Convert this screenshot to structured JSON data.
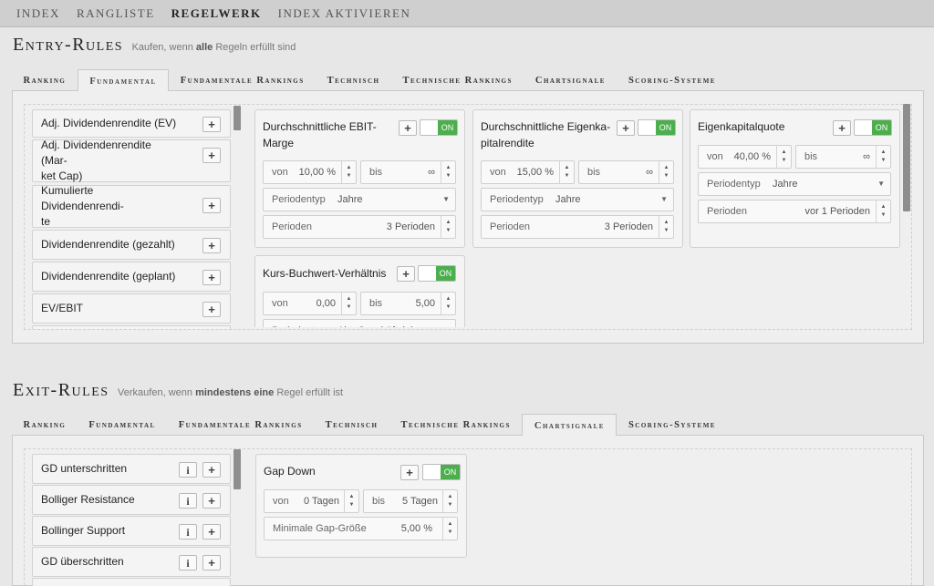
{
  "topnav": [
    {
      "label": "INDEX",
      "active": false
    },
    {
      "label": "RANGLISTE",
      "active": false
    },
    {
      "label": "REGELWERK",
      "active": true
    },
    {
      "label": "INDEX AKTIVIEREN",
      "active": false
    }
  ],
  "entry": {
    "title": "Entry-Rules",
    "sub_pre": "Kaufen, wenn ",
    "sub_bold": "alle",
    "sub_post": " Regeln erfüllt sind",
    "tabs": [
      "Ranking",
      "Fundamental",
      "Fundamentale Rankings",
      "Technisch",
      "Technische Rankings",
      "Chartsignale",
      "Scoring-Systeme"
    ],
    "active_tab": "Fundamental",
    "list": [
      "Adj. Dividendenrendite (EV)",
      "Adj. Dividendenrendite (Mar-\nket Cap)",
      "Kumulierte Dividendenrendi-\nte",
      "Dividendenrendite (gezahlt)",
      "Dividendenrendite (geplant)",
      "EV/EBIT"
    ],
    "cards": {
      "ebit": {
        "title": "Durchschnittliche EBIT-\nMarge",
        "toggle": "ON",
        "von_label": "von",
        "von_value": "10,00 %",
        "bis_label": "bis",
        "bis_value": "∞",
        "periodentyp_label": "Periodentyp",
        "periodentyp_value": "Jahre",
        "perioden_label": "Perioden",
        "perioden_value": "3 Perioden"
      },
      "ek": {
        "title": "Durchschnittliche Eigenka-\npitalrendite",
        "toggle": "ON",
        "von_label": "von",
        "von_value": "15,00 %",
        "bis_label": "bis",
        "bis_value": "∞",
        "periodentyp_label": "Periodentyp",
        "periodentyp_value": "Jahre",
        "perioden_label": "Perioden",
        "perioden_value": "3 Perioden"
      },
      "ekq": {
        "title": "Eigenkapitalquote",
        "toggle": "ON",
        "von_label": "von",
        "von_value": "40,00 %",
        "bis_label": "bis",
        "bis_value": "∞",
        "periodentyp_label": "Periodentyp",
        "periodentyp_value": "Jahre",
        "perioden_label": "Perioden",
        "perioden_value": "vor 1 Perioden"
      },
      "kbv": {
        "title": "Kurs-Buchwert-Verhältnis",
        "toggle": "ON",
        "von_label": "von",
        "von_value": "0,00",
        "bis_label": "bis",
        "bis_value": "5,00",
        "periodentyp_label": "Periodentyp",
        "periodentyp_value": "Akt. Geschäftsjahr"
      }
    }
  },
  "exit": {
    "title": "Exit-Rules",
    "sub_pre": "Verkaufen, wenn ",
    "sub_bold": "mindestens eine",
    "sub_post": " Regel erfüllt ist",
    "tabs": [
      "Ranking",
      "Fundamental",
      "Fundamentale Rankings",
      "Technisch",
      "Technische Rankings",
      "Chartsignale",
      "Scoring-Systeme"
    ],
    "active_tab": "Chartsignale",
    "list": [
      "GD unterschritten",
      "Bolliger Resistance",
      "Bollinger Support",
      "GD überschritten"
    ],
    "card": {
      "title": "Gap Down",
      "toggle": "ON",
      "von_label": "von",
      "von_value": "0 Tagen",
      "bis_label": "bis",
      "bis_value": "5 Tagen",
      "gap_label": "Minimale Gap-Größe",
      "gap_value": "5,00 %"
    }
  },
  "icons": {
    "plus": "+",
    "info": "i",
    "up": "▲",
    "down": "▼",
    "dropdown": "▼"
  },
  "colors": {
    "toggle_on": "#4cae4c",
    "scrollbar": "#8e8e8e"
  }
}
